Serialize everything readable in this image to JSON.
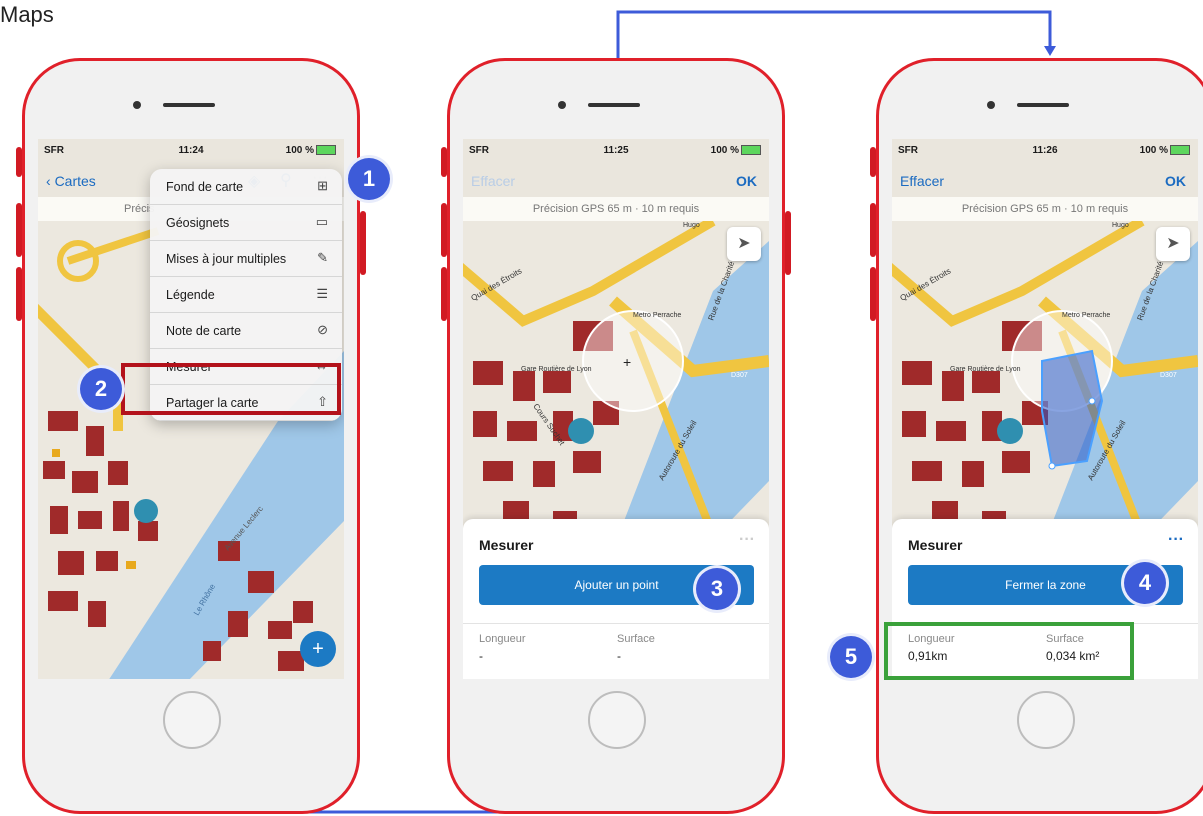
{
  "title": "Maps",
  "status": {
    "carrier": "SFR",
    "battery": "100 %",
    "times": [
      "11:24",
      "11:25",
      "11:26"
    ]
  },
  "phone1": {
    "back_label": "Cartes",
    "gps_partial": "Précis",
    "menu": [
      {
        "label": "Fond de carte",
        "icon": "grid-icon",
        "glyph": "⊞"
      },
      {
        "label": "Géosignets",
        "icon": "book-icon",
        "glyph": "▭"
      },
      {
        "label": "Mises à jour multiples",
        "icon": "edit-icon",
        "glyph": "✎"
      },
      {
        "label": "Légende",
        "icon": "list-icon",
        "glyph": "☰"
      },
      {
        "label": "Note de carte",
        "icon": "note-icon",
        "glyph": "⊘"
      },
      {
        "label": "Mesurer",
        "icon": "arrows-icon",
        "glyph": "↔"
      },
      {
        "label": "Partager la carte",
        "icon": "share-icon",
        "glyph": "⇧"
      }
    ],
    "fab": "+"
  },
  "phone2": {
    "clear_label": "Effacer",
    "ok_label": "OK",
    "gps": "Précision GPS 65 m · 10 m requis",
    "panel_title": "Mesurer",
    "more": "···",
    "button": "Ajouter un point",
    "len_label": "Longueur",
    "surf_label": "Surface",
    "len_value": "-",
    "surf_value": "-"
  },
  "phone3": {
    "clear_label": "Effacer",
    "ok_label": "OK",
    "gps": "Précision GPS 65 m · 10 m requis",
    "panel_title": "Mesurer",
    "more": "···",
    "button": "Fermer la zone",
    "len_label": "Longueur",
    "surf_label": "Surface",
    "len_value": "0,91km",
    "surf_value": "0,034 km²"
  },
  "map_labels": {
    "gare": "Gare Routière de Lyon",
    "metro": "Metro Perrache",
    "cours": "Cours Suchet",
    "autoroute": "Autoroute du Soleil",
    "rue": "Rue de la Charité",
    "quai": "Quai des Étroits",
    "hugo": "Hugo",
    "d307": "D307",
    "leclerc": "Avenue Leclerc",
    "rhone": "Le Rhône"
  },
  "callouts": [
    "1",
    "2",
    "3",
    "4",
    "5"
  ],
  "colors": {
    "accent": "#1c7ac4",
    "badge": "#3d5bd9",
    "highlight_red": "#b3121b",
    "highlight_green": "#3aa13a",
    "phone_frame": "#e0202a",
    "connector": "#3d5bd9"
  }
}
